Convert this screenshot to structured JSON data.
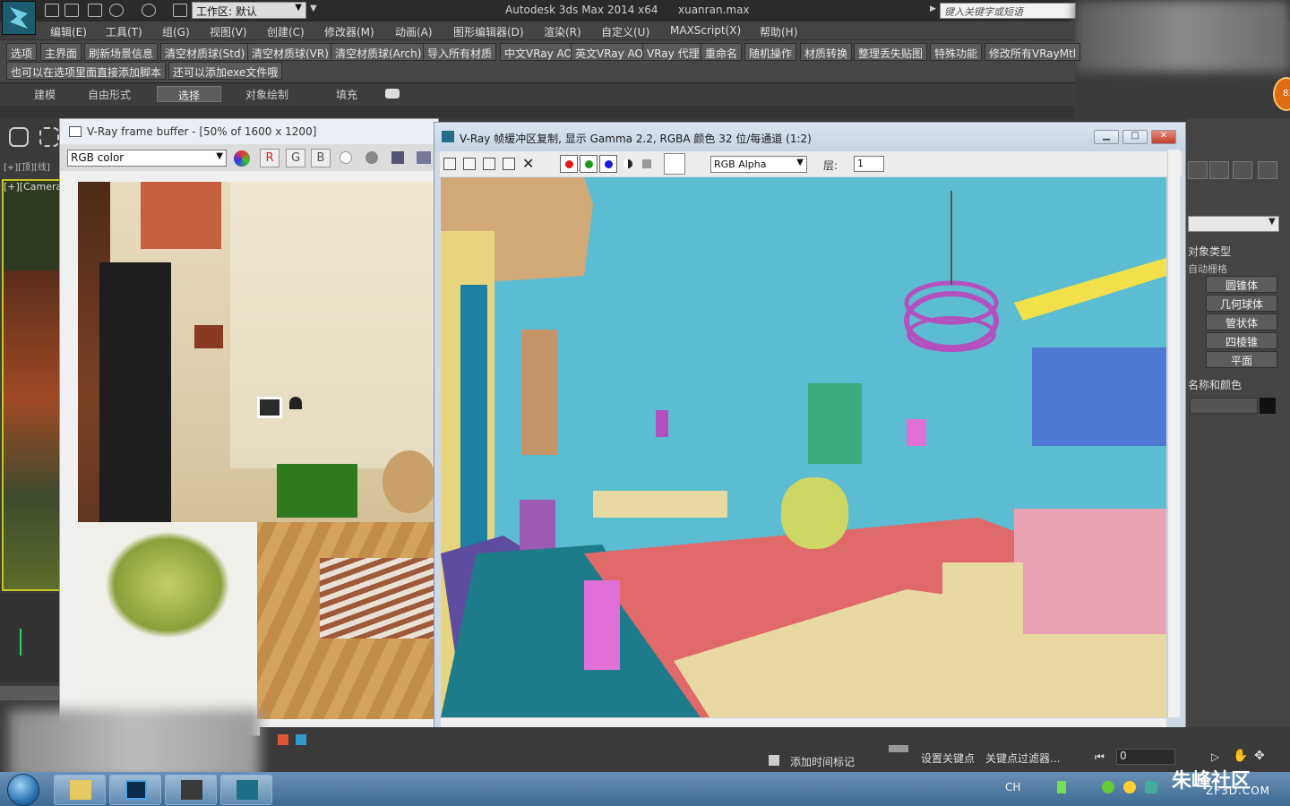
{
  "window": {
    "app_title": "Autodesk 3ds Max  2014 x64",
    "file_name": "xuanran.max",
    "workspace_label": "工作区: 默认",
    "search_placeholder": "键入关键字或短语"
  },
  "menu": [
    "编辑(E)",
    "工具(T)",
    "组(G)",
    "视图(V)",
    "创建(C)",
    "修改器(M)",
    "动画(A)",
    "图形编辑器(D)",
    "渲染(R)",
    "自定义(U)",
    "MAXScript(X)",
    "帮助(H)"
  ],
  "plugin_toolbar": {
    "row1": [
      "选项",
      "主界面",
      "刷新场景信息",
      "清空材质球(Std)",
      "清空材质球(VR)",
      "清空材质球(Arch)",
      "导入所有材质",
      "中文VRay AO",
      "英文VRay AO",
      "VRay 代理",
      "重命名",
      "随机操作",
      "材质转换",
      "整理丢失贴图",
      "特殊功能",
      "修改所有VRayMtl"
    ],
    "row2": [
      "也可以在选项里面直接添加脚本",
      "还可以添加exe文件哦"
    ]
  },
  "ribbon_tabs": [
    {
      "label": "建模",
      "active": false
    },
    {
      "label": "自由形式",
      "active": false
    },
    {
      "label": "选择",
      "active": true
    },
    {
      "label": "对象绘制",
      "active": false
    },
    {
      "label": "填充",
      "active": false
    }
  ],
  "viewport": {
    "label": "[+][Camera"
  },
  "vfb_main": {
    "title": "V-Ray frame buffer - [50% of 1600 x 1200]",
    "channel": "RGB color",
    "channel_buttons": [
      "R",
      "G",
      "B"
    ]
  },
  "vfb_copy": {
    "title": "V-Ray 帧缓冲区复制, 显示 Gamma 2.2, RGBA 颜色 32 位/每通道 (1:2)",
    "channel": "RGB Alpha",
    "layer_label": "层:",
    "layer_value": "1"
  },
  "command_panel": {
    "object_type_header": "对象类型",
    "auto_grid": "自动栅格",
    "primitives": [
      "圆锥体",
      "几何球体",
      "管状体",
      "四棱锥",
      "平面"
    ],
    "name_color_header": "名称和颜色"
  },
  "bottom": {
    "add_time_tag": "添加时间标记",
    "set_key": "设置关键点",
    "key_filters": "关键点过滤器...",
    "frame_value": "0"
  },
  "taskbar": {
    "tray_lang": "CH",
    "watermark": "朱峰社区",
    "watermark_sub": "ZF3D.COM",
    "badge": "83"
  },
  "colors": {
    "max_bg": "#3b3b3b",
    "viewport_highlight": "#c7c520",
    "vfb_copy_bg": "#5cbdd2"
  }
}
